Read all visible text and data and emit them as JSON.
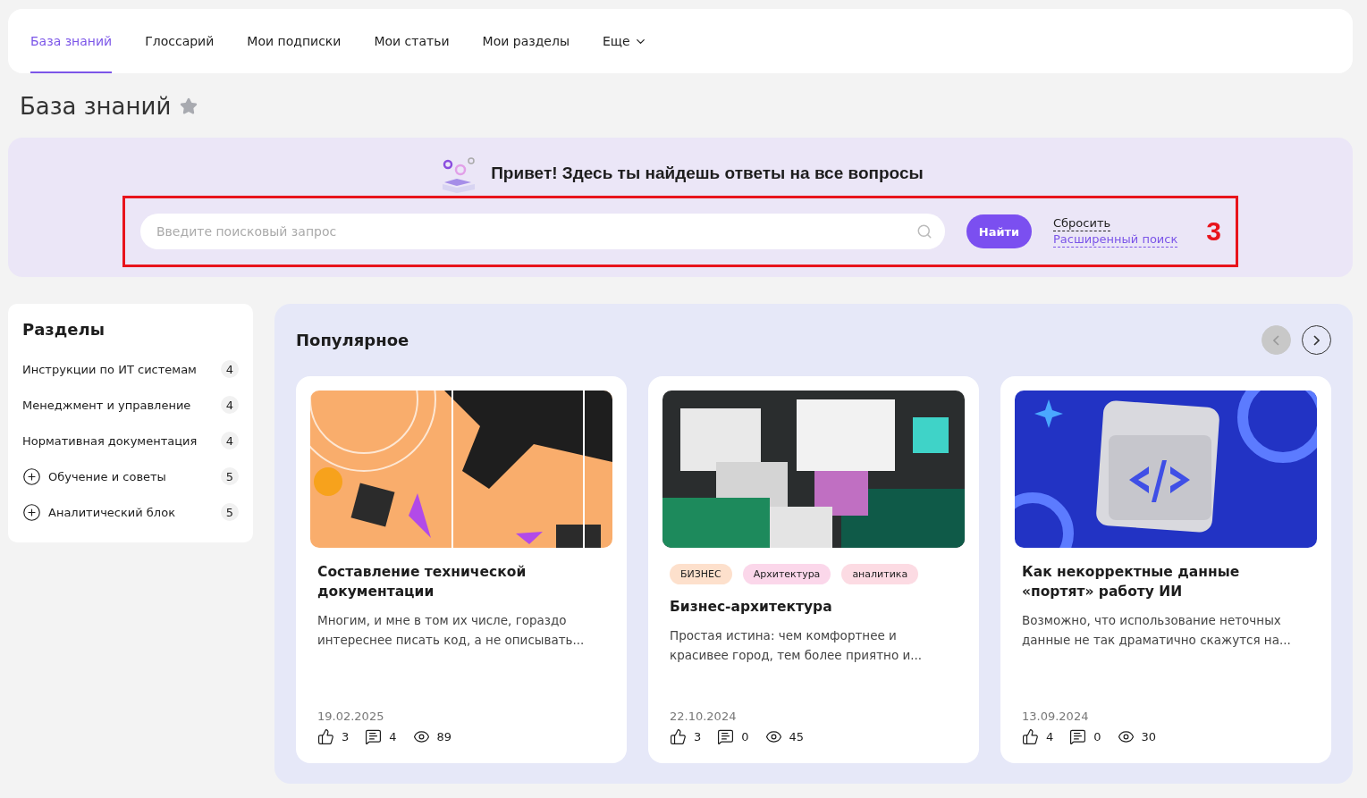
{
  "nav": {
    "tabs": [
      {
        "label": "База знаний",
        "selected": true
      },
      {
        "label": "Глоссарий",
        "selected": false
      },
      {
        "label": "Мои подписки",
        "selected": false
      },
      {
        "label": "Мои статьи",
        "selected": false
      },
      {
        "label": "Мои разделы",
        "selected": false
      },
      {
        "label": "Еще",
        "selected": false,
        "kind": "dropdown"
      }
    ]
  },
  "page_title": "База знаний",
  "favorite": false,
  "hero": {
    "greeting": "Привет! Здесь ты найдешь ответы на все вопросы",
    "search": {
      "placeholder": "Введите поисковый запрос"
    },
    "find_button": "Найти",
    "reset_link": "Сбросить",
    "advanced_link": "Расширенный поиск",
    "annotation": "3"
  },
  "sections": {
    "title": "Разделы",
    "items": [
      {
        "label": "Инструкции по ИТ системам",
        "count": "4",
        "expandable": false
      },
      {
        "label": "Менеджмент и управление",
        "count": "4",
        "expandable": false
      },
      {
        "label": "Нормативная документация",
        "count": "4",
        "expandable": false
      },
      {
        "label": "Обучение и советы",
        "count": "5",
        "expandable": true
      },
      {
        "label": "Аналитический блок",
        "count": "5",
        "expandable": true
      }
    ]
  },
  "popular": {
    "title": "Популярное",
    "prev_disabled": true,
    "next_disabled": false,
    "cards": [
      {
        "kind": "picture",
        "title": "Составление технической документации",
        "excerpt": "Многим, и мне в том их числе, гораздо интереснее писать код, а не описывать...",
        "date": "19.02.2025",
        "likes": "3",
        "comments": "4",
        "views": "89"
      },
      {
        "kind": "picture",
        "tags": [
          {
            "label": "БИЗНЕС",
            "color": "#fde0cc"
          },
          {
            "label": "Архитектура",
            "color": "#fbd7ea"
          },
          {
            "label": "аналитика",
            "color": "#fcdbe3"
          }
        ],
        "title": "Бизнес-архитектура",
        "excerpt": "Простая истина: чем комфортнее и красивее город, тем более приятно и...",
        "date": "22.10.2024",
        "likes": "3",
        "comments": "0",
        "views": "45"
      },
      {
        "kind": "picture",
        "title": "Как некорректные данные «портят» работу ИИ",
        "excerpt": "Возможно, что использование неточных данные не так драматично скажутся на...",
        "date": "13.09.2024",
        "likes": "4",
        "comments": "0",
        "views": "30"
      }
    ]
  }
}
